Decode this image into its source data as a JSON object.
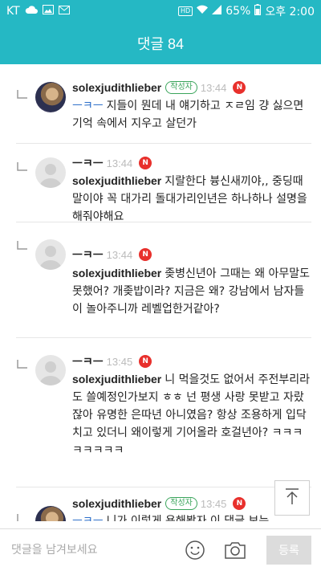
{
  "status_bar": {
    "carrier": "KT",
    "battery": "65%",
    "time": "오후 2:00",
    "hd": "HD",
    "icons": [
      "cloud-icon",
      "image-icon",
      "mail-icon",
      "wifi-icon",
      "signal-icon",
      "battery-icon"
    ]
  },
  "header": {
    "title": "댓글 84",
    "background": "#25b8c4"
  },
  "comments": [
    {
      "author": "solexjudithlieber",
      "badge": "작성자",
      "time": "13:44",
      "new": "N",
      "mention": "ㅡㅋㅡ",
      "text": "지들이 뭔데 내 얘기하고 ㅈㄹ임 걍 싫으면 기억 속에서 지우고 살던가",
      "avatar": "profile-photo"
    },
    {
      "author": "ㅡㅋㅡ",
      "time": "13:44",
      "new": "N",
      "mention": "solexjudithlieber",
      "text": "지랄한다 븅신새끼야,, 중딩때말이야 꼭 대가리 돌대가리인년은 하나하나 설명을 해줘야해요",
      "avatar": "default-profile"
    },
    {
      "author": "ㅡㅋㅡ",
      "time": "13:44",
      "new": "N",
      "mention": "solexjudithlieber",
      "text": "좆병신년아 그때는 왜 아무말도 못했어? 개좆밥이라? 지금은 왜? 강남에서 남자들이 놀아주니까 레벨업한거같아?",
      "avatar": "default-profile"
    },
    {
      "author": "ㅡㅋㅡ",
      "time": "13:45",
      "new": "N",
      "mention": "solexjudithlieber",
      "text": "니 먹을것도 없어서 주전부리라도 쓸예정인가보지 ㅎㅎ 넌 평생 사랑 못받고 자랐잖아 유명한 은따년 아니였음? 항상 조용하게 입닥치고 있더니 왜이렇게 기어올라 호걸년아? ㅋㅋㅋㅋㅋㅋㅋㅋ",
      "avatar": "default-profile"
    },
    {
      "author": "solexjudithlieber",
      "badge": "작성자",
      "time": "13:45",
      "new": "N",
      "mention": "ㅡㅋㅡ",
      "text": "니가 이렇게 욕해봤자 이 댓글 보는",
      "avatar": "profile-photo"
    }
  ],
  "input_bar": {
    "placeholder": "댓글을 남겨보세요",
    "submit_label": "등록",
    "emoji_icon": "emoji-icon",
    "camera_icon": "camera-icon"
  },
  "scroll_top_icon": "arrow-up-icon"
}
